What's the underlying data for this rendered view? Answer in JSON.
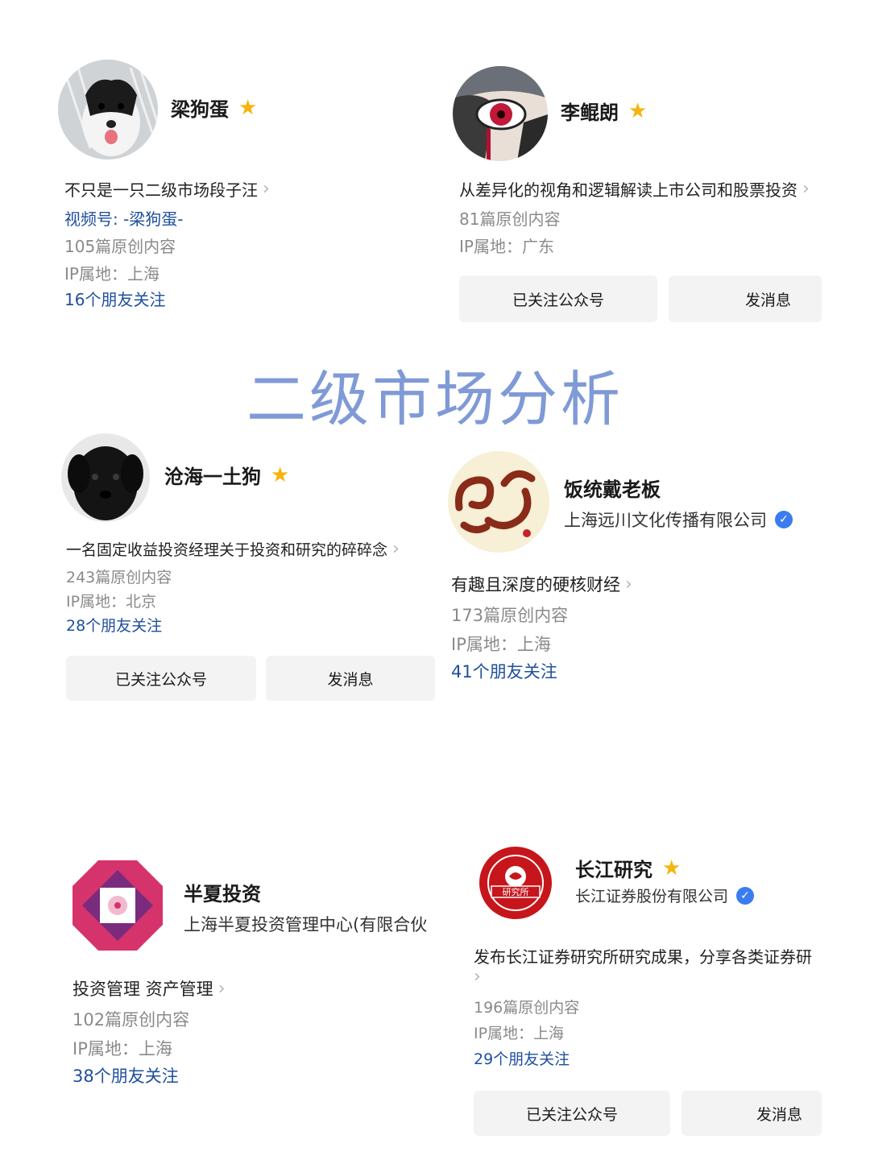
{
  "headline": "二级市场分析",
  "accounts": [
    {
      "name": "梁狗蛋",
      "badge": "star-icon",
      "description": "不只是一只二级市场段子汪",
      "channel": "视频号: -梁狗蛋-",
      "articles": "105篇原创内容",
      "ip": "IP属地：上海",
      "friends": "16个朋友关注"
    },
    {
      "name": "李鲲朗",
      "badge": "star-icon",
      "description": "从差异化的视角和逻辑解读上市公司和股票投资",
      "articles": "81篇原创内容",
      "ip": "IP属地：广东",
      "follow_button": "已关注公众号",
      "message_button": "发消息"
    },
    {
      "name": "沧海一土狗",
      "badge": "star-icon",
      "description": "一名固定收益投资经理关于投资和研究的碎碎念",
      "articles": "243篇原创内容",
      "ip": "IP属地：北京",
      "friends": "28个朋友关注",
      "follow_button": "已关注公众号",
      "message_button": "发消息"
    },
    {
      "name": "饭统戴老板",
      "company": "上海远川文化传播有限公司",
      "badge": "verified-icon",
      "description": "有趣且深度的硬核财经",
      "articles": "173篇原创内容",
      "ip": "IP属地：上海",
      "friends": "41个朋友关注"
    },
    {
      "name": "半夏投资",
      "company": "上海半夏投资管理中心(有限合伙",
      "description": "投资管理 资产管理",
      "articles": "102篇原创内容",
      "ip": "IP属地：上海",
      "friends": "38个朋友关注"
    },
    {
      "name": "长江研究",
      "badge": "star-icon",
      "company": "长江证券股份有限公司",
      "description": "发布长江证券研究所研究成果，分享各类证券研",
      "articles": "196篇原创内容",
      "ip": "IP属地：上海",
      "friends": "29个朋友关注",
      "follow_button": "已关注公众号",
      "message_button": "发消息",
      "logo_text": "研究所"
    }
  ],
  "colors": {
    "headline": "#7f9ad6",
    "link_blue": "#1f4f9c",
    "star": "#f6b40e",
    "verified": "#3b7cf0"
  }
}
